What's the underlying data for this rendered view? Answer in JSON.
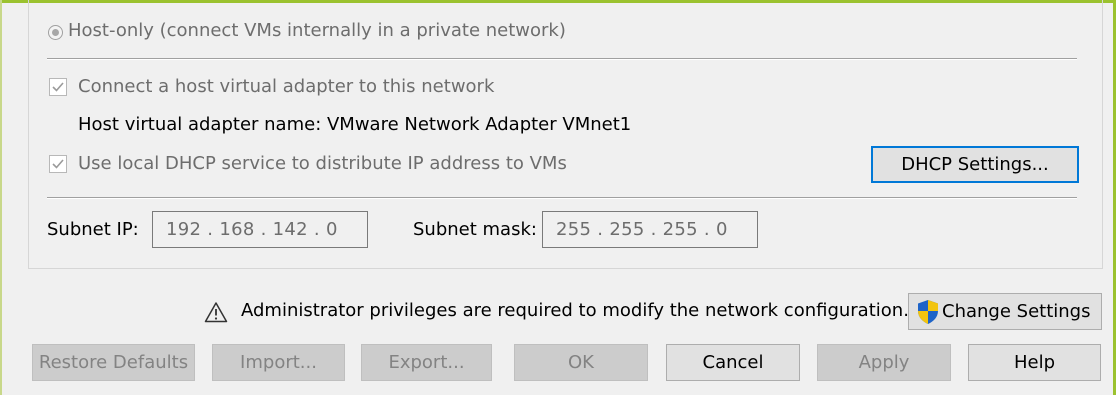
{
  "network_type": {
    "host_only_label": "Host-only (connect VMs internally in a private network)"
  },
  "host_adapter": {
    "connect_label": "Connect a host virtual adapter to this network",
    "adapter_name_label": "Host virtual adapter name: VMware Network Adapter VMnet1"
  },
  "dhcp": {
    "use_dhcp_label": "Use local DHCP service to distribute IP address to VMs",
    "settings_button": "DHCP Settings..."
  },
  "subnet": {
    "ip_label": "Subnet IP:",
    "ip_value": "192 . 168 . 142 .  0",
    "mask_label": "Subnet mask:",
    "mask_value": "255 . 255 . 255 .  0"
  },
  "admin": {
    "warning_text": "Administrator privileges are required to modify the network configuration.",
    "change_settings_button": "Change Settings"
  },
  "footer_buttons": {
    "restore_defaults": "Restore Defaults",
    "import": "Import...",
    "export": "Export...",
    "ok": "OK",
    "cancel": "Cancel",
    "apply": "Apply",
    "help": "Help"
  },
  "colors": {
    "accent": "#9bc22f",
    "focus": "#0078d7",
    "shield_blue": "#1e64c8",
    "shield_yellow": "#f2c40f"
  }
}
